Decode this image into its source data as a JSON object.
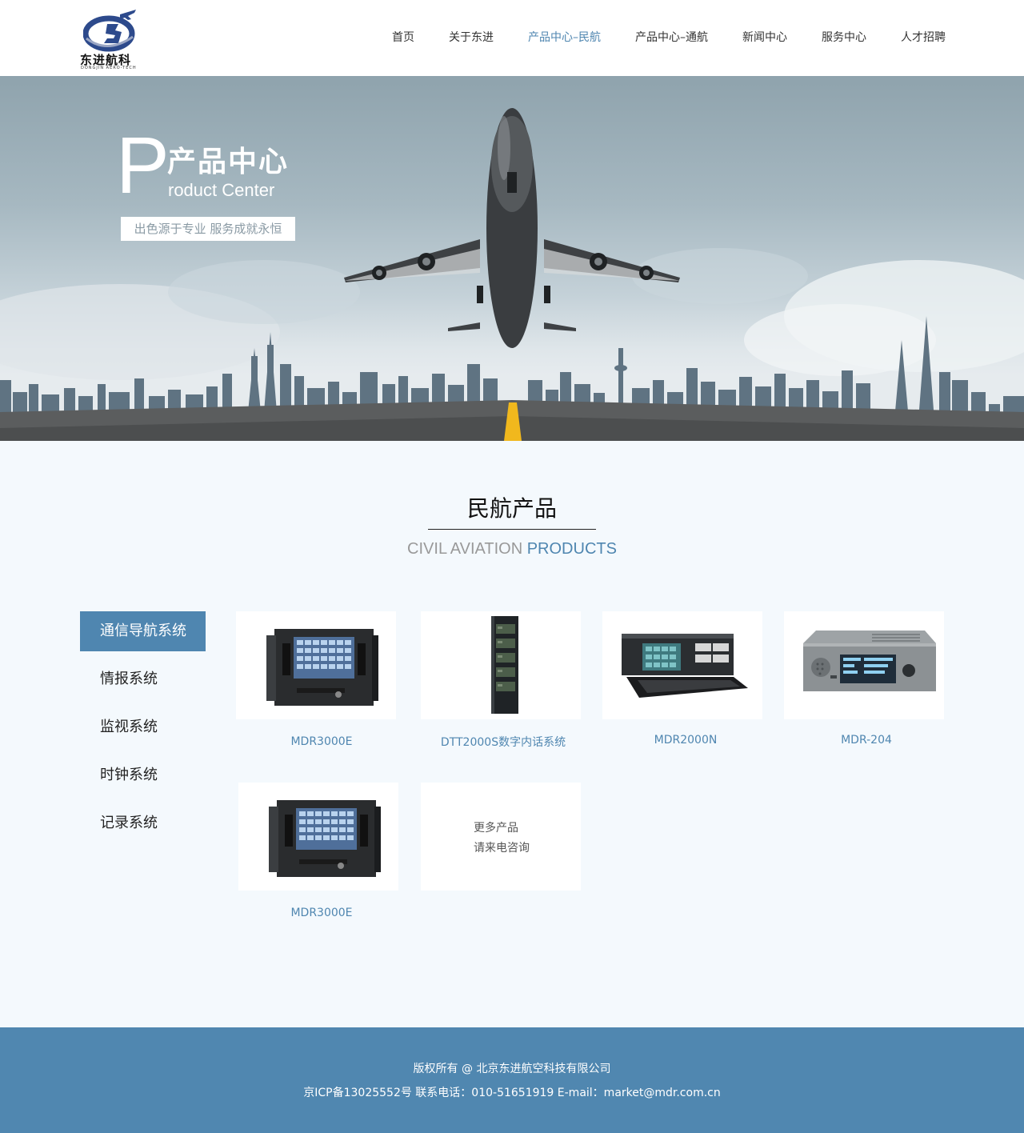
{
  "header": {
    "logo_text": "东进航科",
    "logo_sub": "DONGJIN AERO-TECH",
    "nav": [
      {
        "label": "首页",
        "active": false
      },
      {
        "label": "关于东进",
        "active": false
      },
      {
        "label": "产品中心–民航",
        "active": true
      },
      {
        "label": "产品中心–通航",
        "active": false
      },
      {
        "label": "新闻中心",
        "active": false
      },
      {
        "label": "服务中心",
        "active": false
      },
      {
        "label": "人才招聘",
        "active": false
      }
    ]
  },
  "banner": {
    "big_letter": "P",
    "title_cn": "产品中心",
    "title_en": "roduct Center",
    "tagline": "出色源于专业 服务成就永恒"
  },
  "section": {
    "title": "民航产品",
    "subtitle_gray": "CIVIL AVIATION ",
    "subtitle_blue": "PRODUCTS"
  },
  "sidebar": {
    "items": [
      {
        "label": "通信导航系统",
        "active": true
      },
      {
        "label": "情报系统",
        "active": false
      },
      {
        "label": "监视系统",
        "active": false
      },
      {
        "label": "时钟系统",
        "active": false
      },
      {
        "label": "记录系统",
        "active": false
      }
    ]
  },
  "products": [
    {
      "name": "MDR3000E",
      "image": "rack-recorder-touchscreen"
    },
    {
      "name": "DTT2000S数字内话系统",
      "image": "tall-cabinet"
    },
    {
      "name": "MDR2000N",
      "image": "rack-console-keyboard"
    },
    {
      "name": "MDR-204",
      "image": "rack-panel-silver"
    },
    {
      "name": "MDR3000E",
      "image": "rack-recorder-touchscreen"
    }
  ],
  "more": {
    "line1": "更多产品",
    "line2": "请来电咨询"
  },
  "footer": {
    "copyright": "版权所有 @ 北京东进航空科技有限公司",
    "contact": "京ICP备13025552号   联系电话：010-51651919    E-mail：market@mdr.com.cn"
  },
  "colors": {
    "accent": "#4f86b0",
    "page_bg": "#f4f9fd",
    "footer_bg": "#5087b0"
  }
}
